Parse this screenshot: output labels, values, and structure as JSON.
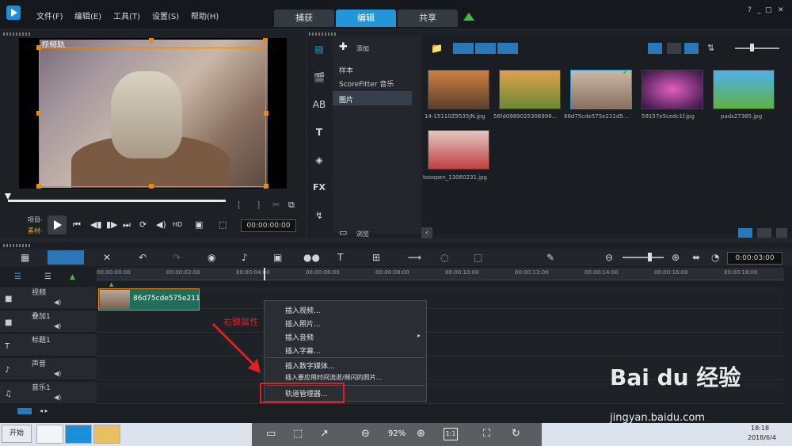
{
  "menu": [
    "文件(F)",
    "编辑(E)",
    "工具(T)",
    "设置(S)",
    "帮助(H)"
  ],
  "tabs": [
    "捕获",
    "编辑",
    "共享"
  ],
  "window_controls": [
    "?",
    "_",
    "□",
    "✕"
  ],
  "preview": {
    "track_label": "视频轨",
    "mode_project": "项目-",
    "mode_clip": "素材-",
    "timecode": "00:00:00:00"
  },
  "library": {
    "add_label": "添加",
    "folders": [
      "样本",
      "ScoreFitter 音乐",
      "图片"
    ],
    "browse_label": "浏览",
    "thumbs": [
      {
        "caption": "14-15110Z9535JN.jpg",
        "bg": "#a07040"
      },
      {
        "caption": "56fd0989025306996...",
        "bg": "#8aa040"
      },
      {
        "caption": "86d75cde575e211d5...",
        "bg": "#b0a090"
      },
      {
        "caption": "59157e5cedc1f.jpg",
        "bg": "#c04080"
      },
      {
        "caption": "pads27385.jpg",
        "bg": "#4aa0e0"
      },
      {
        "caption": "tooopen_13060231.jpg",
        "bg": "#d0b0a8"
      }
    ]
  },
  "timeline": {
    "timecode": "0:00:03:00",
    "ticks": [
      "00:00:00:00",
      "00:00:02:00",
      "00:00:04:00",
      "00:00:06:00",
      "00:00:08:00",
      "00:00:10:00",
      "00:00:12:00",
      "00:00:14:00",
      "00:00:16:00",
      "00:00:18:00"
    ],
    "tracks": [
      "视频",
      "叠加1",
      "标题1",
      "声音",
      "音乐1"
    ],
    "clip_name": "86d75cde575e211"
  },
  "context_menu": [
    "插入视频...",
    "插入照片...",
    "插入音频",
    "插入字幕...",
    "插入数字媒体...",
    "插入要应用时间流逝/频闪的照片...",
    "轨道管理器..."
  ],
  "annotation": "右键属性",
  "taskbar": {
    "start": "开始",
    "zoom": "92%",
    "one_to_one": "1:1",
    "time": "18:18",
    "date": "2018/6/4"
  },
  "watermark": {
    "brand": "Bai du 经验",
    "url": "jingyan.baidu.com"
  }
}
